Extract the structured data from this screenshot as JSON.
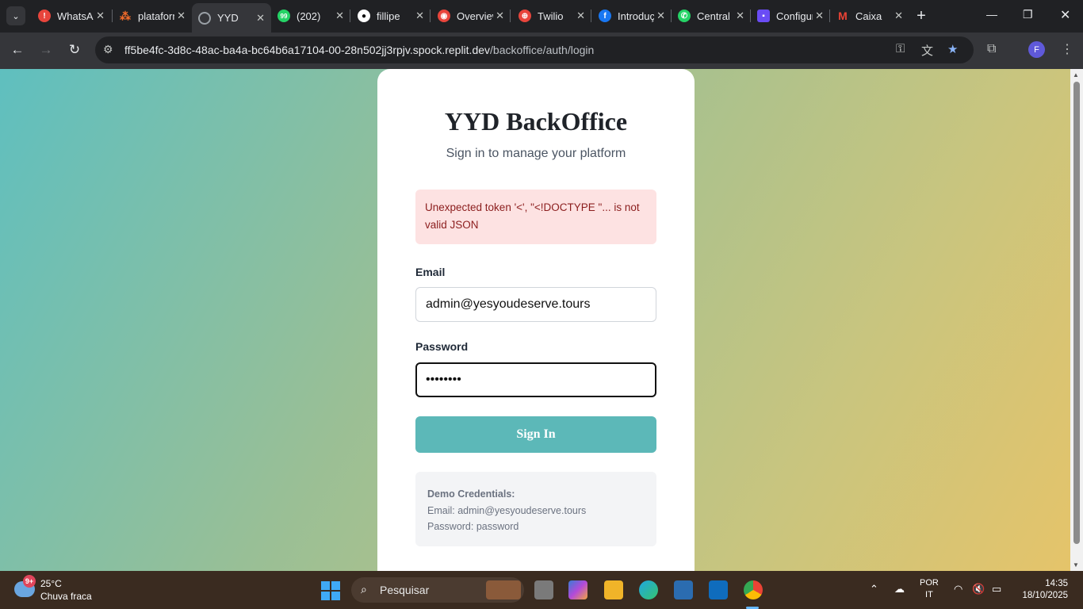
{
  "browser": {
    "tabs": [
      {
        "title": "WhatsApp",
        "color": "#e8453c",
        "glyph": "!"
      },
      {
        "title": "plataforma",
        "color": "#f26b2a",
        "glyph": "◆"
      },
      {
        "title": "YYD - BackOffice",
        "color": "#9aa0a6",
        "glyph": "◎"
      },
      {
        "title": "(202)",
        "color": "#25d366",
        "glyph": "99"
      },
      {
        "title": "fillipe",
        "color": "#ffffff",
        "glyph": "●"
      },
      {
        "title": "Overview",
        "color": "#e8453c",
        "glyph": "◉"
      },
      {
        "title": "Twilio",
        "color": "#e8453c",
        "glyph": "⊕"
      },
      {
        "title": "Introdução",
        "color": "#1877f2",
        "glyph": "f"
      },
      {
        "title": "Central",
        "color": "#25d366",
        "glyph": "✆"
      },
      {
        "title": "Configurações",
        "color": "#6a4cf5",
        "glyph": "▣"
      },
      {
        "title": "Caixa",
        "color": "#ea4335",
        "glyph": "M"
      }
    ],
    "url_host": "ff5be4fc-3d8c-48ac-ba4a-bc64b6a17104-00-28n502jj3rpjv.spock.replit.dev",
    "url_path": "/backoffice/auth/login",
    "profile_initial": "F"
  },
  "login": {
    "title": "YYD BackOffice",
    "subtitle": "Sign in to manage your platform",
    "error": "Unexpected token '<', \"<!DOCTYPE \"... is not valid JSON",
    "email_label": "Email",
    "email_value": "admin@yesyoudeserve.tours",
    "password_label": "Password",
    "password_value": "password",
    "submit_label": "Sign In",
    "demo_title": "Demo Credentials:",
    "demo_email": "Email: admin@yesyoudeserve.tours",
    "demo_password": "Password: password"
  },
  "taskbar": {
    "weather_temp": "25°C",
    "weather_desc": "Chuva fraca",
    "weather_badge": "9+",
    "search_placeholder": "Pesquisar",
    "lang_top": "POR",
    "lang_bottom": "IT",
    "time": "14:35",
    "date": "18/10/2025"
  }
}
